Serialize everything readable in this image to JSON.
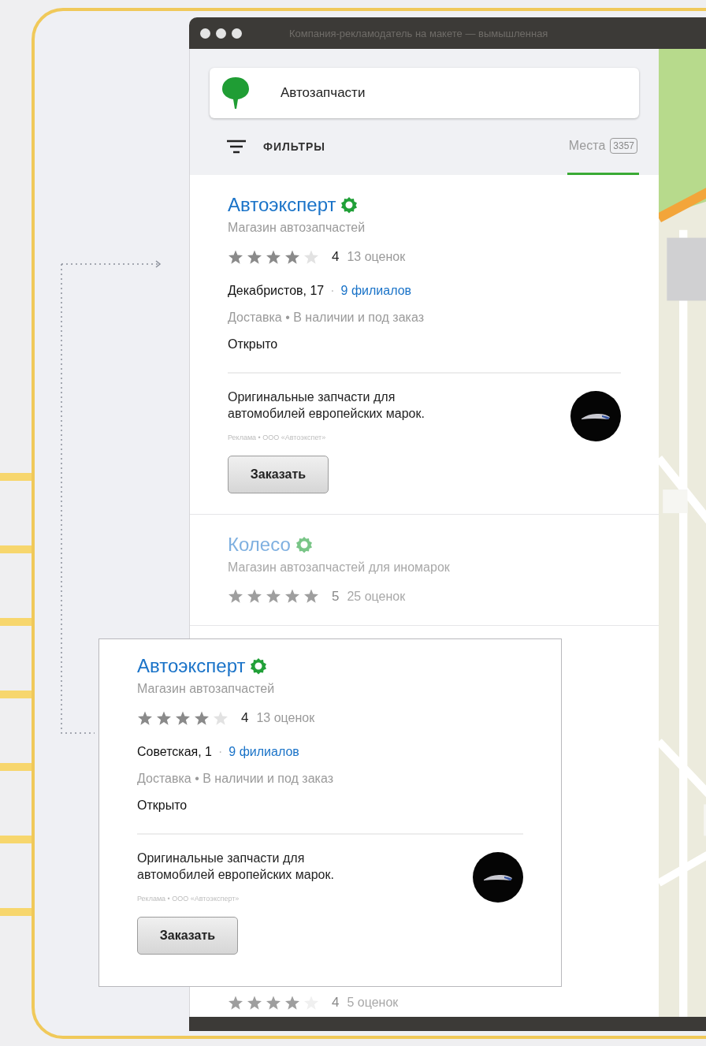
{
  "window": {
    "title": "Компания-рекламодатель на макете — вымышленная"
  },
  "search": {
    "value": "Автозапчасти"
  },
  "filters": {
    "label": "ФИЛЬТРЫ"
  },
  "tabs": [
    {
      "label": "Места",
      "count": "3357",
      "selected": true
    }
  ],
  "results": [
    {
      "name": "Автоэксперт",
      "verified": true,
      "dimmed": false,
      "subtitle": "Магазин автозапчастей",
      "stars": 4,
      "rating": "4",
      "reviews": "13 оценок",
      "address": "Декабристов, 17",
      "separator": "·",
      "branches": "9 филиалов",
      "features": "Доставка • В наличии и под заказ",
      "status": "Открыто",
      "ad": {
        "text": "Оригинальные запчасти для автомобилей европейских марок.",
        "legal": "Реклама • ООО «Автоэкспет»",
        "button": "Заказать"
      }
    },
    {
      "name": "Колесо",
      "verified": true,
      "dimmed": true,
      "subtitle": "Магазин автозапчастей для иномарок",
      "stars": 5,
      "rating": "5",
      "reviews": "25 оценок"
    },
    {
      "dimmed": true,
      "stars": 4,
      "rating": "4",
      "reviews": "5 оценок"
    }
  ],
  "callout": {
    "name": "Автоэксперт",
    "verified": true,
    "subtitle": "Магазин автозапчастей",
    "stars": 4,
    "rating": "4",
    "reviews": "13 оценок",
    "address": "Советская, 1",
    "separator": "·",
    "branches": "9 филиалов",
    "features": "Доставка • В наличии и под заказ",
    "status": "Открыто",
    "ad": {
      "text": "Оригинальные запчасти для автомобилей европейских марок.",
      "legal": "Реклама • ООО «Автоэксперт»",
      "button": "Заказать"
    }
  }
}
